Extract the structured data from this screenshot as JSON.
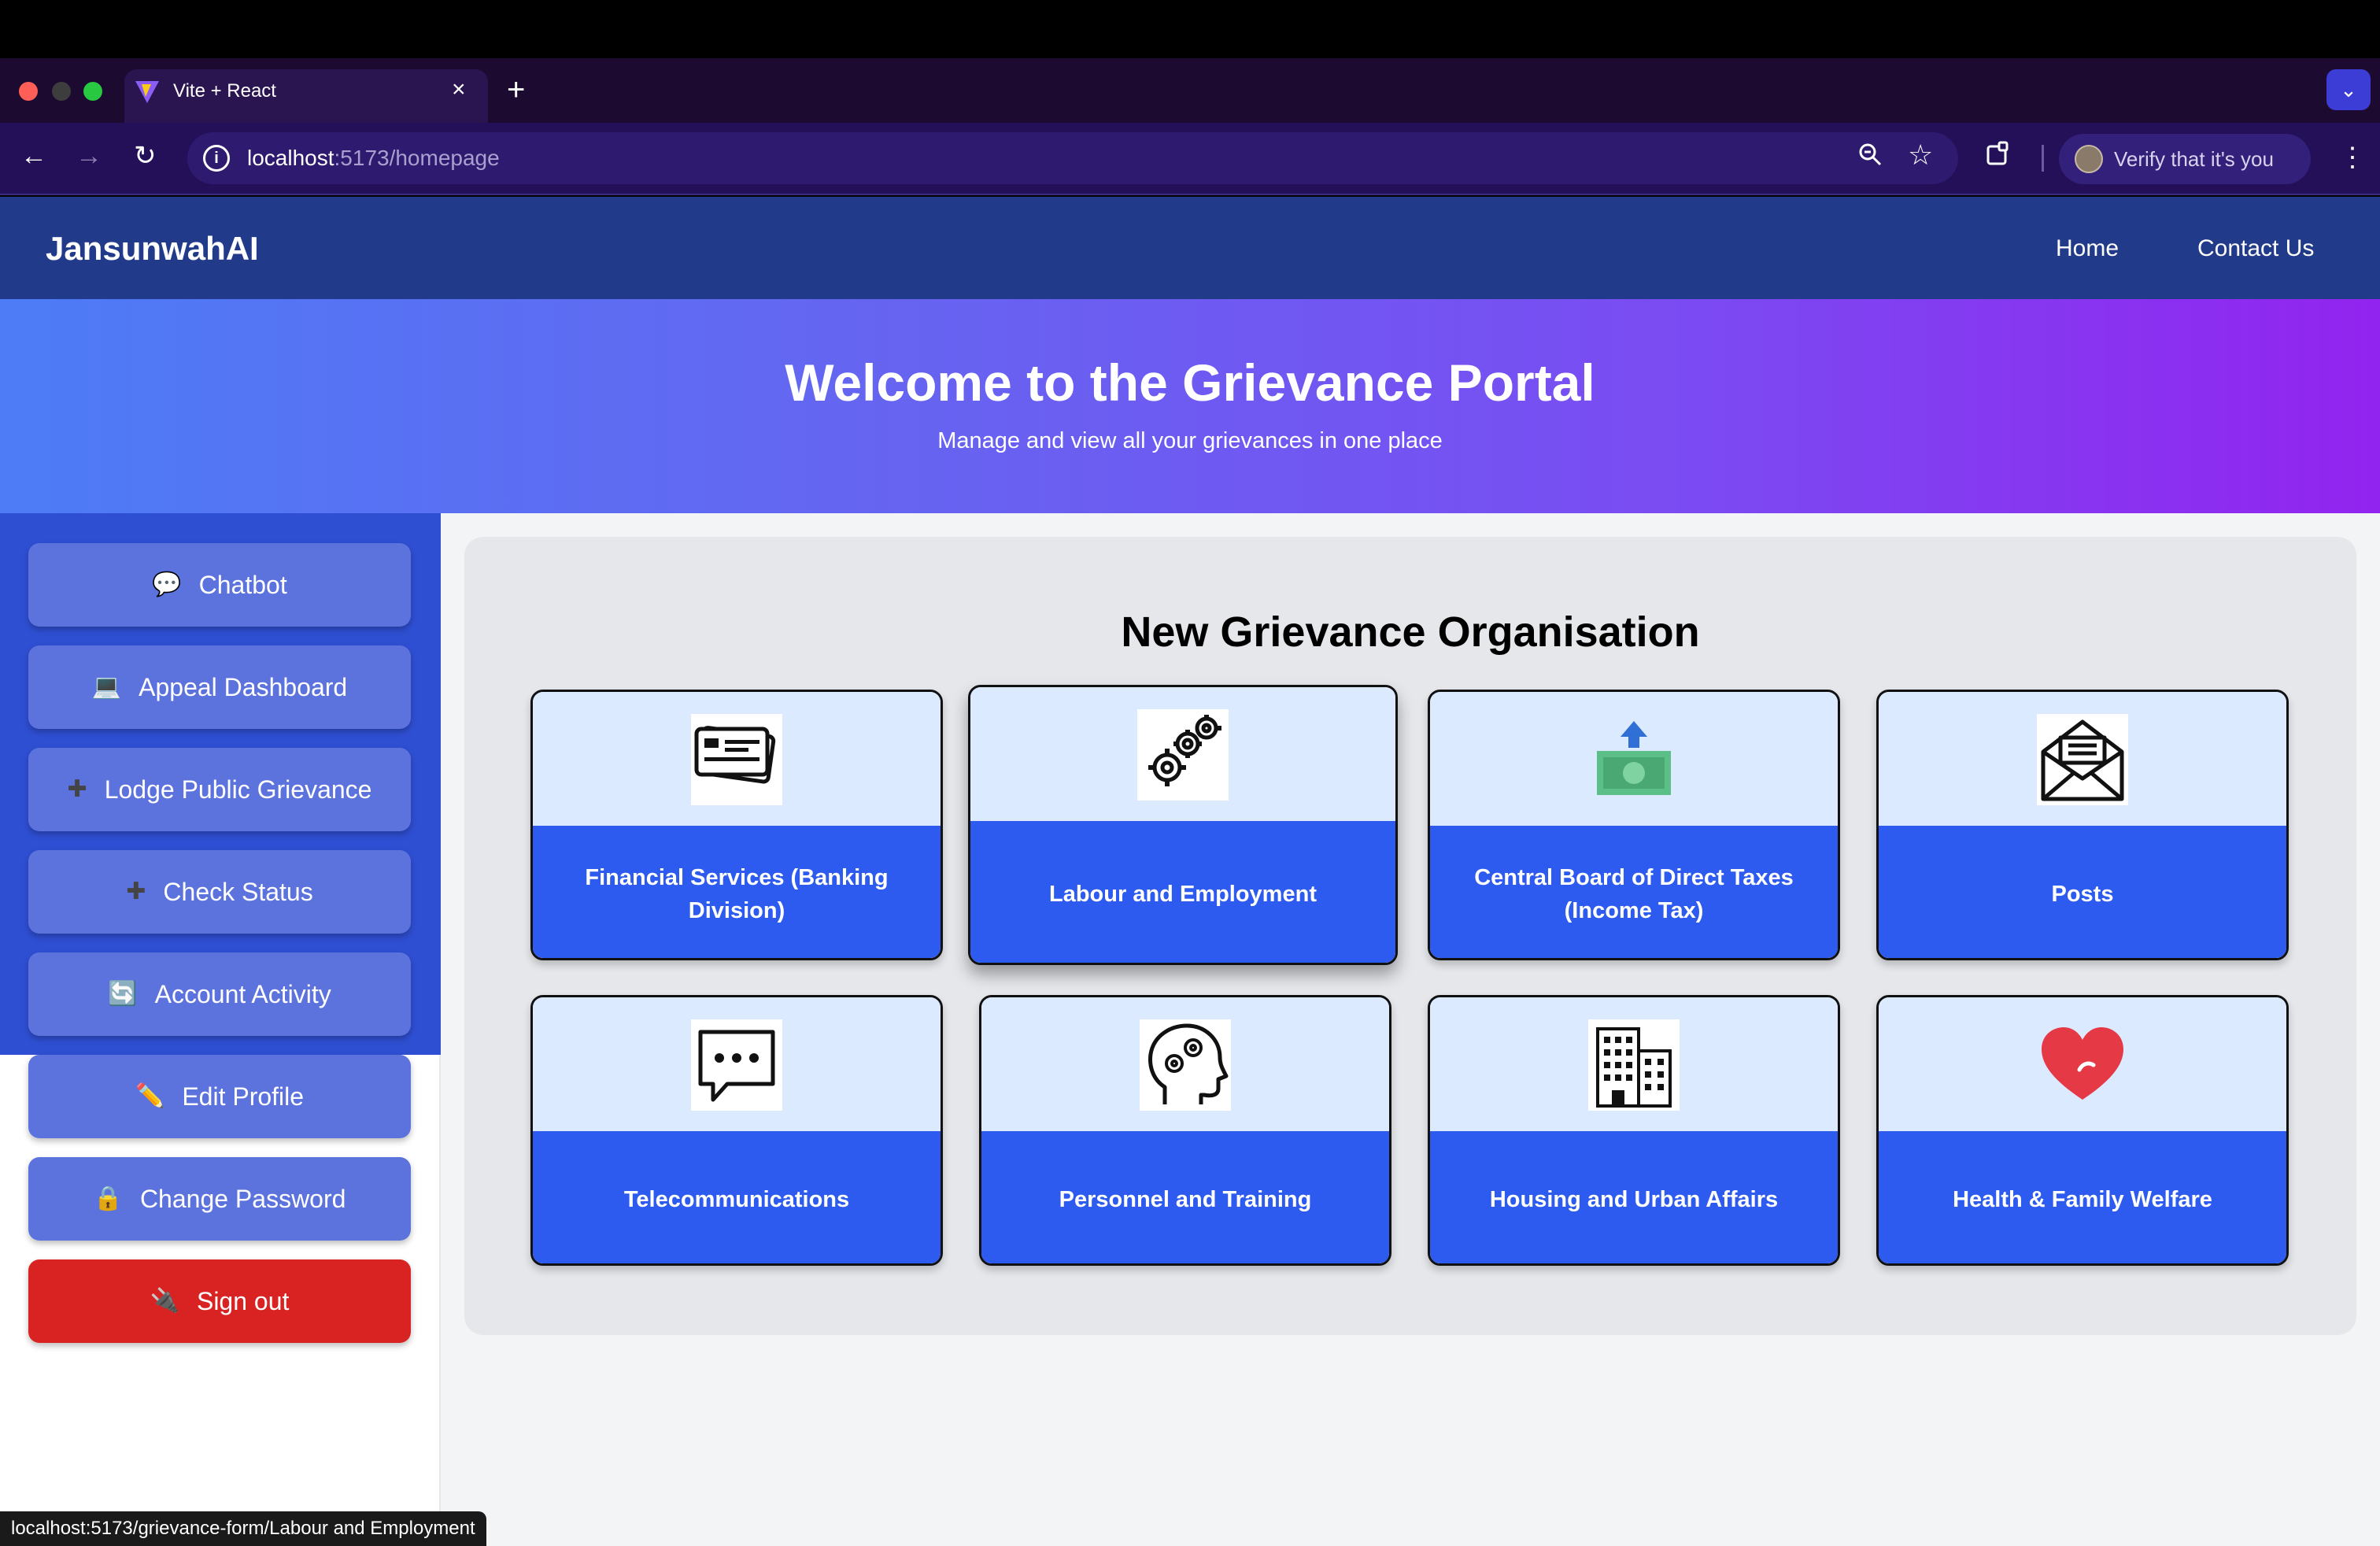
{
  "browser": {
    "tab_title": "Vite + React",
    "tab_close": "×",
    "new_tab": "+",
    "tab_menu": "⌄",
    "url_host": "localhost",
    "url_path": ":5173/homepage",
    "verify_label": "Verify that it's you",
    "status_url": "localhost:5173/grievance-form/Labour and Employment"
  },
  "navbar": {
    "brand": "JansunwahAI",
    "links": [
      "Home",
      "Contact Us"
    ]
  },
  "hero": {
    "title": "Welcome to the Grievance Portal",
    "subtitle": "Manage and view all your grievances in one place"
  },
  "sidebar": {
    "items": [
      {
        "label": "Chatbot",
        "icon": "speech-bubble-icon"
      },
      {
        "label": "Appeal Dashboard",
        "icon": "computer-icon"
      },
      {
        "label": "Lodge Public Grievance",
        "icon": "plus-icon"
      },
      {
        "label": "Check Status",
        "icon": "plus-icon"
      },
      {
        "label": "Account Activity",
        "icon": "refresh-icon"
      },
      {
        "label": "Edit Profile",
        "icon": "pencil-icon"
      },
      {
        "label": "Change Password",
        "icon": "lock-icon"
      },
      {
        "label": "Sign out",
        "icon": "plug-icon"
      }
    ]
  },
  "main": {
    "section_title": "New Grievance Organisation",
    "tiles": [
      {
        "label": "Financial Services (Banking Division)",
        "icon": "credit-card-icon"
      },
      {
        "label": "Labour and Employment",
        "icon": "gears-icon"
      },
      {
        "label": "Central Board of Direct Taxes (Income Tax)",
        "icon": "money-upload-icon"
      },
      {
        "label": "Posts",
        "icon": "envelope-icon"
      },
      {
        "label": "Telecommunications",
        "icon": "chat-bubble-icon"
      },
      {
        "label": "Personnel and Training",
        "icon": "head-gears-icon"
      },
      {
        "label": "Housing and Urban Affairs",
        "icon": "building-icon"
      },
      {
        "label": "Health & Family Welfare",
        "icon": "heart-icon"
      }
    ]
  },
  "colors": {
    "navbar": "#223a8a",
    "sidebar_panel": "#2f4fd3",
    "sidebar_button": "#5c73de",
    "signout_button": "#d92323",
    "tile_footer": "#2d5bef",
    "tile_header": "#dbeafe"
  }
}
